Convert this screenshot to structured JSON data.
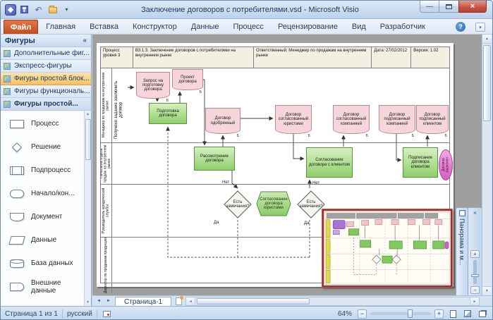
{
  "glyphs": {
    "up": "▲",
    "down": "▼",
    "left": "◄",
    "right": "►"
  },
  "titlebar": {
    "title": "Заключение договоров с потребителями.vsd - Microsoft Visio",
    "undo_glyph": "↶",
    "qat_dropdown_glyph": "▾",
    "minimize_glyph": "—",
    "close_glyph": "×"
  },
  "ribbon": {
    "tabs": [
      "Файл",
      "Главная",
      "Вставка",
      "Конструктор",
      "Данные",
      "Процесс",
      "Рецензирование",
      "Вид",
      "Разработчик"
    ],
    "help_glyph": "?",
    "expand_glyph": "▾"
  },
  "shapes_panel": {
    "title": "Фигуры",
    "collapse_glyph": "«",
    "stencils": [
      {
        "label": "Дополнительные фиг..."
      },
      {
        "label": "Экспресс-фигуры"
      },
      {
        "label": "Фигуры простой блок..."
      },
      {
        "label": "Фигуры функциональ..."
      }
    ],
    "active_title": "Фигуры простой...",
    "shapes": [
      {
        "label": "Процесс"
      },
      {
        "label": "Решение"
      },
      {
        "label": "Подпроцесс"
      },
      {
        "label": "Начало/кон..."
      },
      {
        "label": "Документ"
      },
      {
        "label": "Данные"
      },
      {
        "label": "База данных"
      },
      {
        "label": "Внешние данные"
      }
    ]
  },
  "diagram": {
    "header": {
      "process_level": "Процесс уровня 3",
      "process_name": "В3.1.3.  Заключение договоров с потребителями на внутреннем рынке",
      "responsible": "Ответственный: Менеджер по продажам на внутреннем рынке",
      "date": "Дата: 27/02/2012",
      "version": "Версия: 1.02"
    },
    "lanes": [
      "Менеджер по продажам на внутреннем рынке",
      "Начальник отдела продаж на внутреннем рынке",
      "Руководитель юридической службы",
      "Директор по продажам продукции"
    ],
    "trigger": "Получено задание заключить договор",
    "tag": "Б",
    "yes": "Да",
    "no": "Нет",
    "nodes": {
      "request": "Запрос на подготовку договора",
      "draft": "Проект договора",
      "prepare": "Подготовка договора",
      "approved": "Договор одобренный",
      "agreed_lawyers": "Договор согласованный юристами",
      "agreed_company": "Договор согласованный компанией",
      "signed_company": "Договор подписанный компанией",
      "signed_client": "Договор подписанный клиентом",
      "review": "Рассмотрение договора",
      "client_agreement": "Согласование договора с клиентом",
      "signing": "Подписание договора клиентом",
      "concluded": "Договор заключен",
      "remarks1": "Есть замечания?",
      "lawyers_agreement": "Согласование договора юристами",
      "remarks2": "Есть замечания?"
    }
  },
  "pan_zoom": {
    "title": "Панорама и м...",
    "close_glyph": "×",
    "plus_glyph": "+",
    "minus_glyph": "−"
  },
  "pagebar": {
    "tab": "Страница-1"
  },
  "statusbar": {
    "page_info": "Страница 1 из 1",
    "language": "русский",
    "zoom": "64%",
    "minus_glyph": "−",
    "plus_glyph": "+"
  }
}
